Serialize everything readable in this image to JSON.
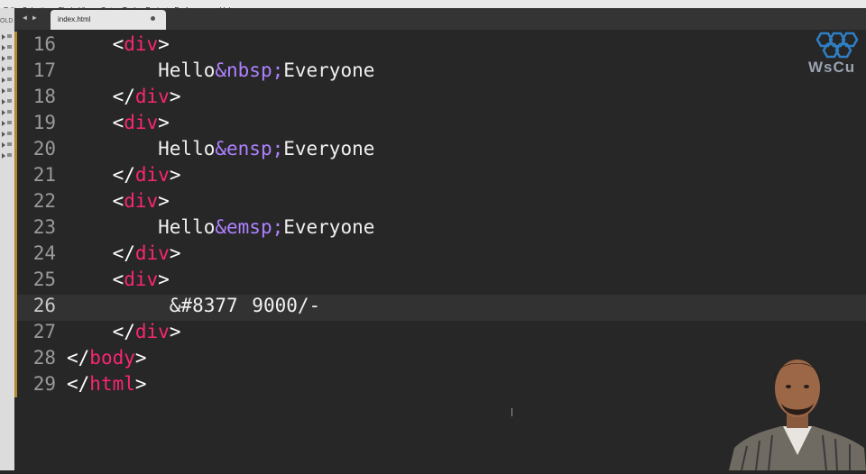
{
  "menu": {
    "items": [
      "Edit",
      "Selection",
      "Find",
      "View",
      "Goto",
      "Tools",
      "Project",
      "Preferences",
      "Help"
    ]
  },
  "sidebar": {
    "folders_label": "OLD"
  },
  "tabs": [
    {
      "label": "index.html",
      "active": true
    }
  ],
  "editor": {
    "active_line": 26,
    "lines": [
      {
        "num": "16",
        "tokens": [
          {
            "t": "    ",
            "c": "txt"
          },
          {
            "t": "<",
            "c": "pun"
          },
          {
            "t": "div",
            "c": "tag"
          },
          {
            "t": ">",
            "c": "pun"
          }
        ]
      },
      {
        "num": "17",
        "tokens": [
          {
            "t": "        Hello",
            "c": "txt"
          },
          {
            "t": "&nbsp;",
            "c": "ent"
          },
          {
            "t": "Everyone",
            "c": "txt"
          }
        ]
      },
      {
        "num": "18",
        "tokens": [
          {
            "t": "    ",
            "c": "txt"
          },
          {
            "t": "</",
            "c": "pun"
          },
          {
            "t": "div",
            "c": "tag"
          },
          {
            "t": ">",
            "c": "pun"
          }
        ]
      },
      {
        "num": "19",
        "tokens": [
          {
            "t": "    ",
            "c": "txt"
          },
          {
            "t": "<",
            "c": "pun"
          },
          {
            "t": "div",
            "c": "tag"
          },
          {
            "t": ">",
            "c": "pun"
          }
        ]
      },
      {
        "num": "20",
        "tokens": [
          {
            "t": "        Hello",
            "c": "txt"
          },
          {
            "t": "&ensp;",
            "c": "ent"
          },
          {
            "t": "Everyone",
            "c": "txt"
          }
        ]
      },
      {
        "num": "21",
        "tokens": [
          {
            "t": "    ",
            "c": "txt"
          },
          {
            "t": "</",
            "c": "pun"
          },
          {
            "t": "div",
            "c": "tag"
          },
          {
            "t": ">",
            "c": "pun"
          }
        ]
      },
      {
        "num": "22",
        "tokens": [
          {
            "t": "    ",
            "c": "txt"
          },
          {
            "t": "<",
            "c": "pun"
          },
          {
            "t": "div",
            "c": "tag"
          },
          {
            "t": ">",
            "c": "pun"
          }
        ]
      },
      {
        "num": "23",
        "tokens": [
          {
            "t": "        Hello",
            "c": "txt"
          },
          {
            "t": "&emsp;",
            "c": "ent"
          },
          {
            "t": "Everyone",
            "c": "txt"
          }
        ]
      },
      {
        "num": "24",
        "tokens": [
          {
            "t": "    ",
            "c": "txt"
          },
          {
            "t": "</",
            "c": "pun"
          },
          {
            "t": "div",
            "c": "tag"
          },
          {
            "t": ">",
            "c": "pun"
          }
        ]
      },
      {
        "num": "25",
        "tokens": [
          {
            "t": "    ",
            "c": "txt"
          },
          {
            "t": "<",
            "c": "pun"
          },
          {
            "t": "div",
            "c": "tag"
          },
          {
            "t": ">",
            "c": "pun"
          }
        ]
      },
      {
        "num": "26",
        "tokens": [
          {
            "t": "         &#8377",
            "c": "txt"
          },
          {
            "t": "|cursor|",
            "c": "cursor"
          },
          {
            "t": " 9000/-",
            "c": "txt"
          }
        ]
      },
      {
        "num": "27",
        "tokens": [
          {
            "t": "    ",
            "c": "txt"
          },
          {
            "t": "</",
            "c": "pun"
          },
          {
            "t": "div",
            "c": "tag"
          },
          {
            "t": ">",
            "c": "pun"
          }
        ]
      },
      {
        "num": "28",
        "tokens": [
          {
            "t": "</",
            "c": "pun"
          },
          {
            "t": "body",
            "c": "tag"
          },
          {
            "t": ">",
            "c": "pun"
          }
        ]
      },
      {
        "num": "29",
        "tokens": [
          {
            "t": "</",
            "c": "pun"
          },
          {
            "t": "html",
            "c": "tag"
          },
          {
            "t": ">",
            "c": "pun"
          }
        ]
      }
    ]
  },
  "watermark": {
    "text": "WsCu"
  },
  "colors": {
    "background": "#272727",
    "tag": "#f92672",
    "entity": "#ae81ff",
    "text": "#f0f0f0",
    "gutter": "#9a9a9a",
    "fold_marker": "#b08a2c"
  }
}
